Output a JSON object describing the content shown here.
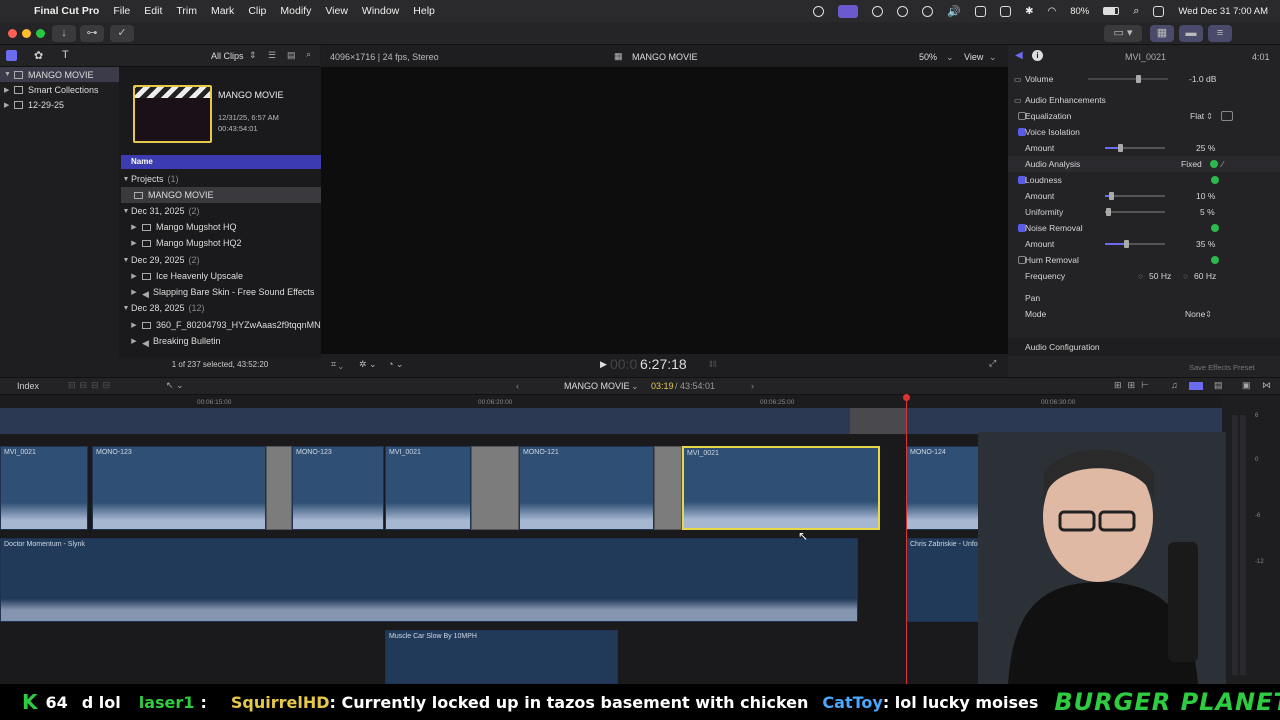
{
  "menubar": {
    "app_name": "Final Cut Pro",
    "menus": [
      "File",
      "Edit",
      "Trim",
      "Mark",
      "Clip",
      "Modify",
      "View",
      "Window",
      "Help"
    ],
    "battery": "80%",
    "datetime": "Wed Dec 31  7:00 AM"
  },
  "library": {
    "filter": "All Clips",
    "items": [
      {
        "label": "MANGO MOVIE",
        "selected": true
      },
      {
        "label": "Smart Collections",
        "selected": false
      },
      {
        "label": "12-29-25",
        "selected": false
      }
    ]
  },
  "browser": {
    "project_title": "MANGO MOVIE",
    "project_date": "12/31/25, 6:57 AM",
    "project_duration": "00:43:54:01",
    "column_header": "Name",
    "rows": [
      {
        "type": "group",
        "label": "Projects",
        "count": "(1)"
      },
      {
        "type": "item",
        "label": "MANGO MOVIE",
        "selected": true
      },
      {
        "type": "group",
        "label": "Dec 31, 2025",
        "count": "(2)"
      },
      {
        "type": "item",
        "label": "Mango Mugshot HQ"
      },
      {
        "type": "item",
        "label": "Mango Mugshot HQ2"
      },
      {
        "type": "group",
        "label": "Dec 29, 2025",
        "count": "(2)"
      },
      {
        "type": "item",
        "label": "Ice Heavenly Upscale"
      },
      {
        "type": "item",
        "label": "Slapping Bare Skin - Free Sound Effects"
      },
      {
        "type": "group",
        "label": "Dec 28, 2025",
        "count": "(12)"
      },
      {
        "type": "item",
        "label": "360_F_80204793_HYZwAaas2f9tqqnMN"
      },
      {
        "type": "item",
        "label": "Breaking Bulletin"
      }
    ],
    "status": "1 of 237 selected, 43:52:20"
  },
  "viewer": {
    "format": "4096×1716 | 24 fps, Stereo",
    "title": "MANGO MOVIE",
    "zoom": "50%",
    "view_label": "View",
    "timecode": "6:27:18",
    "timecode_prefix": "00:0"
  },
  "inspector": {
    "clip_name": "MVI_0021",
    "duration": "4:01",
    "volume_label": "Volume",
    "volume_value": "-1.0  dB",
    "section": "Audio Enhancements",
    "equalization_label": "Equalization",
    "equalization_value": "Flat",
    "voice_isolation_label": "Voice Isolation",
    "voice_amount_label": "Amount",
    "voice_amount": "25  %",
    "voice_level": 0.25,
    "analysis_label": "Audio Analysis",
    "analysis_value": "Fixed",
    "loudness_label": "Loudness",
    "loudness_amount_label": "Amount",
    "loudness_amount": "10  %",
    "loudness_level": 0.1,
    "uniformity_label": "Uniformity",
    "uniformity": "5  %",
    "uniformity_level": 0.05,
    "noise_label": "Noise Removal",
    "noise_amount_label": "Amount",
    "noise_amount": "35  %",
    "noise_level": 0.35,
    "hum_label": "Hum Removal",
    "frequency_label": "Frequency",
    "freq_50": "50 Hz",
    "freq_60": "60 Hz",
    "pan_label": "Pan",
    "mode_label": "Mode",
    "mode_value": "None",
    "audio_config_label": "Audio Configuration",
    "save_preset_label": "Save Effects Preset"
  },
  "timeline": {
    "index_label": "Index",
    "project_name": "MANGO MOVIE",
    "position": "03:19",
    "total": "43:54:01",
    "ruler_labels": [
      "00:06:15:00",
      "00:06:20:00",
      "00:06:25:00",
      "00:06:30:00"
    ],
    "meter_labels": [
      "6",
      "0",
      "-6",
      "-12"
    ],
    "clips": [
      "MVI_0021",
      "MONO-123",
      "MONO-123",
      "MVI_0021",
      "MONO-121",
      "MVI_0021",
      "MONO-124"
    ],
    "music_1": "Doctor Momentum - Slynk",
    "music_2": "Chris Zabriskie - Unfoldment, Revealment",
    "sfx": "Muscle Car Slow By 10MPH"
  },
  "chat": {
    "count": "64",
    "segments": [
      {
        "user": "",
        "text": "d lol"
      },
      {
        "user": "laser1",
        "text": ":"
      },
      {
        "user": "SquirrelHD",
        "text": ": Currently locked up in tazos basement with chicken"
      },
      {
        "user": "CatToy",
        "text": ": lol lucky moises"
      }
    ],
    "brand": "BURGER PLANET"
  }
}
